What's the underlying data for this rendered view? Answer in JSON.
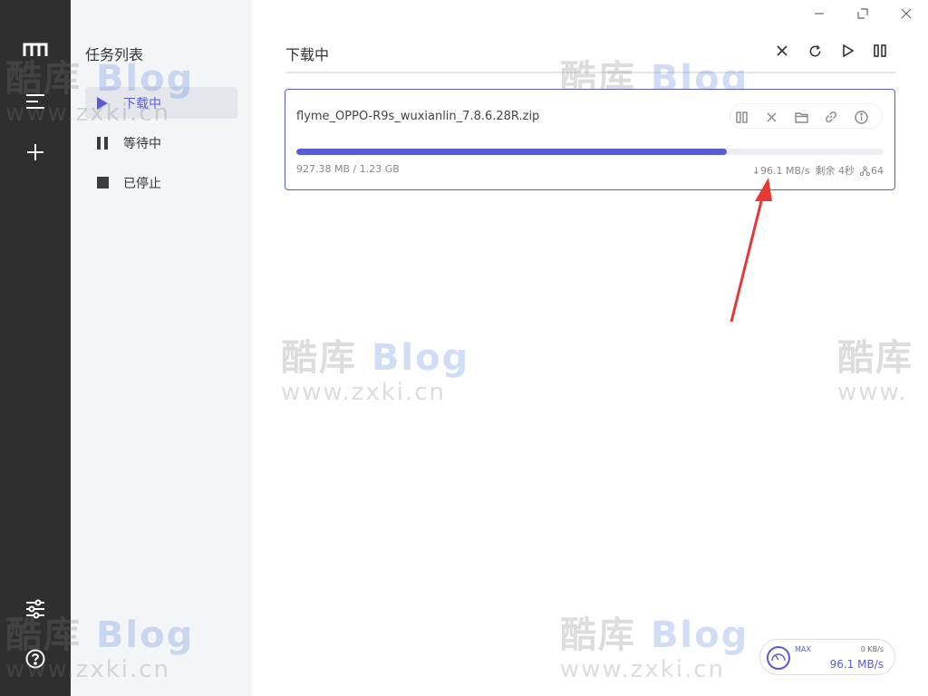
{
  "sidebar": {
    "title": "任务列表",
    "items": [
      {
        "label": "下载中"
      },
      {
        "label": "等待中"
      },
      {
        "label": "已停止"
      }
    ]
  },
  "main": {
    "title": "下载中"
  },
  "task": {
    "filename": "flyme_OPPO-R9s_wuxianlin_7.8.6.28R.zip",
    "progress_fraction": 0.733,
    "size_text": "927.38 MB / 1.23 GB",
    "speed": "↓96.1 MB/s",
    "remaining": "剩余 4秒",
    "connections": "64"
  },
  "speedometer": {
    "max_label": "MAX",
    "upload": "0 KB/s",
    "download": "96.1 MB/s"
  },
  "watermark": {
    "line1_a": "酷库",
    "line1_b": "Blog",
    "line2": "www.zxki.cn"
  },
  "colors": {
    "accent": "#5b5bd6",
    "rail": "#2f2f2f",
    "sidebar": "#f4f5f7",
    "annotation": "#e53935"
  }
}
